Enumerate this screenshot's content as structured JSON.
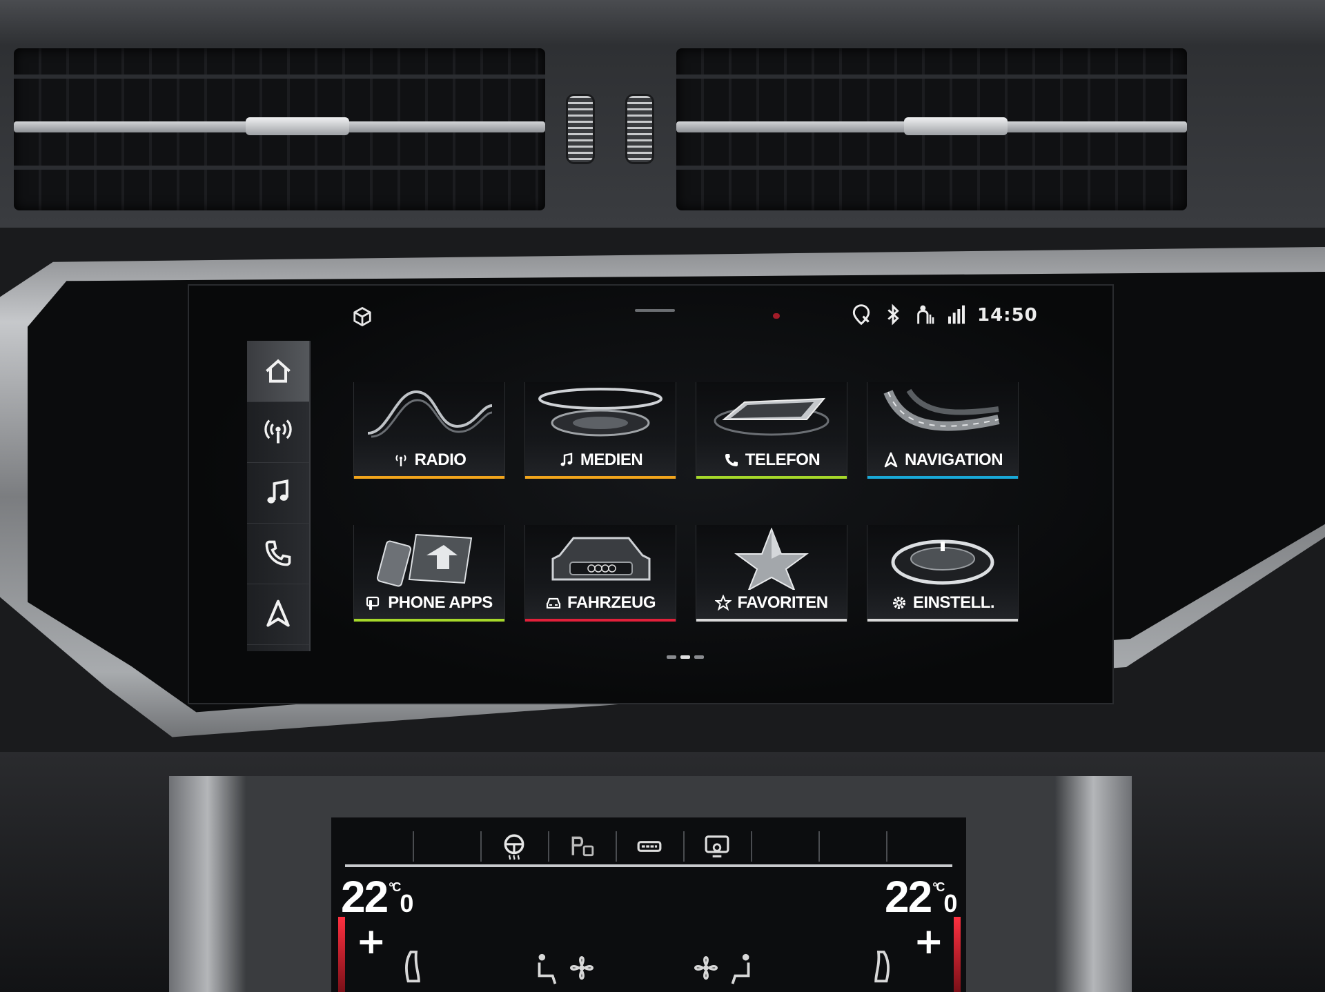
{
  "status_bar": {
    "time": "14:50",
    "icons": [
      "cube-icon",
      "location-shield-icon",
      "bluetooth-icon",
      "person-seat-icon",
      "signal-icon"
    ]
  },
  "sidebar": {
    "items": [
      {
        "icon": "home-icon",
        "active": true
      },
      {
        "icon": "radio-antenna-icon",
        "active": false
      },
      {
        "icon": "music-note-icon",
        "active": false
      },
      {
        "icon": "phone-icon",
        "active": false
      },
      {
        "icon": "navigation-arrow-icon",
        "active": false
      }
    ]
  },
  "tiles": {
    "radio": {
      "label": "RADIO",
      "icon": "radio-antenna-icon",
      "color": "#f2a51c"
    },
    "medien": {
      "label": "MEDIEN",
      "icon": "music-note-icon",
      "color": "#f2a51c"
    },
    "telefon": {
      "label": "TELEFON",
      "icon": "phone-icon",
      "color": "#a6d82a"
    },
    "navigation": {
      "label": "NAVIGATION",
      "icon": "navigation-arrow-icon",
      "color": "#19a9d8"
    },
    "phone_apps": {
      "label": "PHONE APPS",
      "icon": "phone-apps-icon",
      "color": "#a6d82a"
    },
    "fahrzeug": {
      "label": "FAHRZEUG",
      "icon": "car-icon",
      "color": "#e2203a"
    },
    "favoriten": {
      "label": "FAVORITEN",
      "icon": "star-icon",
      "color": "#d8d8d8"
    },
    "einstell": {
      "label": "EINSTELL.",
      "icon": "gear-icon",
      "color": "#d8d8d8"
    }
  },
  "pager": {
    "pages": 3,
    "current": 2
  },
  "climate": {
    "left_temp": {
      "main": "22",
      "unit": "°C",
      "decimal": "0"
    },
    "right_temp": {
      "main": "22",
      "unit": "°C",
      "decimal": "0"
    },
    "plus_left": "+",
    "plus_right": "+",
    "tabs": [
      "",
      "",
      "steering-wheel-heat-icon",
      "parking-heater-icon",
      "rear-window-heat-icon",
      "screen-icon",
      "",
      "",
      ""
    ]
  }
}
